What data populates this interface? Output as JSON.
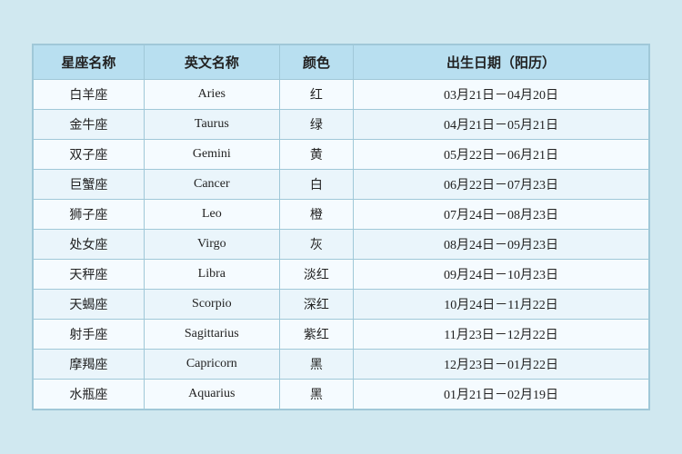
{
  "table": {
    "headers": {
      "col1": "星座名称",
      "col2": "英文名称",
      "col3": "颜色",
      "col4": "出生日期（阳历）"
    },
    "rows": [
      {
        "cn": "白羊座",
        "en": "Aries",
        "color": "红",
        "date": "03月21日－04月20日"
      },
      {
        "cn": "金牛座",
        "en": "Taurus",
        "color": "绿",
        "date": "04月21日－05月21日"
      },
      {
        "cn": "双子座",
        "en": "Gemini",
        "color": "黄",
        "date": "05月22日－06月21日"
      },
      {
        "cn": "巨蟹座",
        "en": "Cancer",
        "color": "白",
        "date": "06月22日－07月23日"
      },
      {
        "cn": "狮子座",
        "en": "Leo",
        "color": "橙",
        "date": "07月24日－08月23日"
      },
      {
        "cn": "处女座",
        "en": "Virgo",
        "color": "灰",
        "date": "08月24日－09月23日"
      },
      {
        "cn": "天秤座",
        "en": "Libra",
        "color": "淡红",
        "date": "09月24日－10月23日"
      },
      {
        "cn": "天蝎座",
        "en": "Scorpio",
        "color": "深红",
        "date": "10月24日－11月22日"
      },
      {
        "cn": "射手座",
        "en": "Sagittarius",
        "color": "紫红",
        "date": "11月23日－12月22日"
      },
      {
        "cn": "摩羯座",
        "en": "Capricorn",
        "color": "黑",
        "date": "12月23日－01月22日"
      },
      {
        "cn": "水瓶座",
        "en": "Aquarius",
        "color": "黑",
        "date": "01月21日－02月19日"
      }
    ]
  }
}
